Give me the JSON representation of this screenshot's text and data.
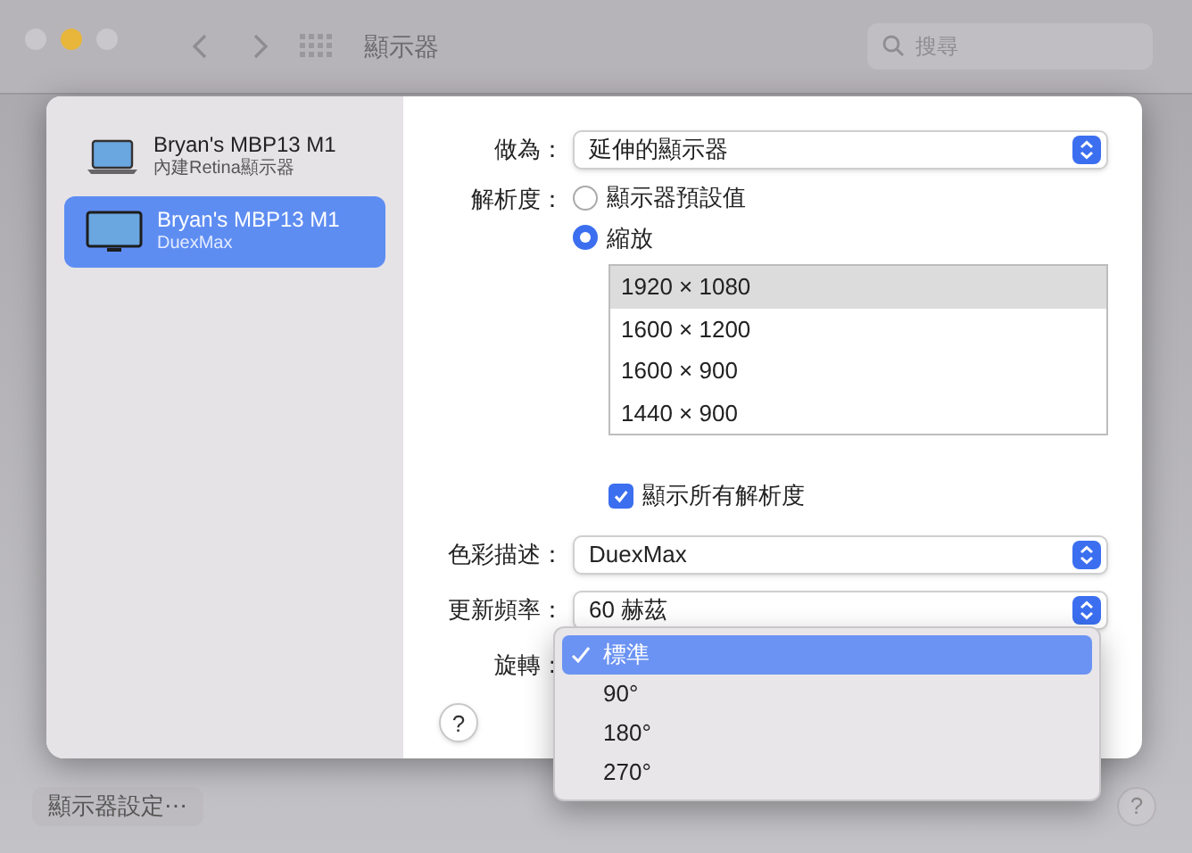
{
  "window": {
    "title": "顯示器",
    "search": {
      "placeholder": "搜尋"
    }
  },
  "displays": [
    {
      "name": "Bryan's MBP13 M1",
      "subtitle": "內建Retina顯示器",
      "kind": "laptop",
      "selected": false
    },
    {
      "name": "Bryan's MBP13 M1",
      "subtitle": "DuexMax",
      "kind": "monitor",
      "selected": true
    }
  ],
  "use_as": {
    "label": "做為：",
    "value": "延伸的顯示器"
  },
  "resolution": {
    "label": "解析度：",
    "options": [
      {
        "label": "顯示器預設值",
        "selected": false
      },
      {
        "label": "縮放",
        "selected": true
      }
    ],
    "sizes": [
      {
        "label": "1920 × 1080",
        "selected": true
      },
      {
        "label": "1600 × 1200",
        "selected": false
      },
      {
        "label": "1600 × 900",
        "selected": false
      },
      {
        "label": "1440 × 900",
        "selected": false
      }
    ],
    "show_all": {
      "label": "顯示所有解析度",
      "checked": true
    }
  },
  "color_profile": {
    "label": "色彩描述：",
    "value": "DuexMax"
  },
  "refresh_rate": {
    "label": "更新頻率：",
    "value": "60 赫茲"
  },
  "rotation": {
    "label": "旋轉：",
    "menu": [
      {
        "label": "標準",
        "selected": true
      },
      {
        "label": "90°",
        "selected": false
      },
      {
        "label": "180°",
        "selected": false
      },
      {
        "label": "270°",
        "selected": false
      }
    ]
  },
  "help": "?",
  "footer": {
    "button": "顯示器設定⋯",
    "help": "?"
  }
}
